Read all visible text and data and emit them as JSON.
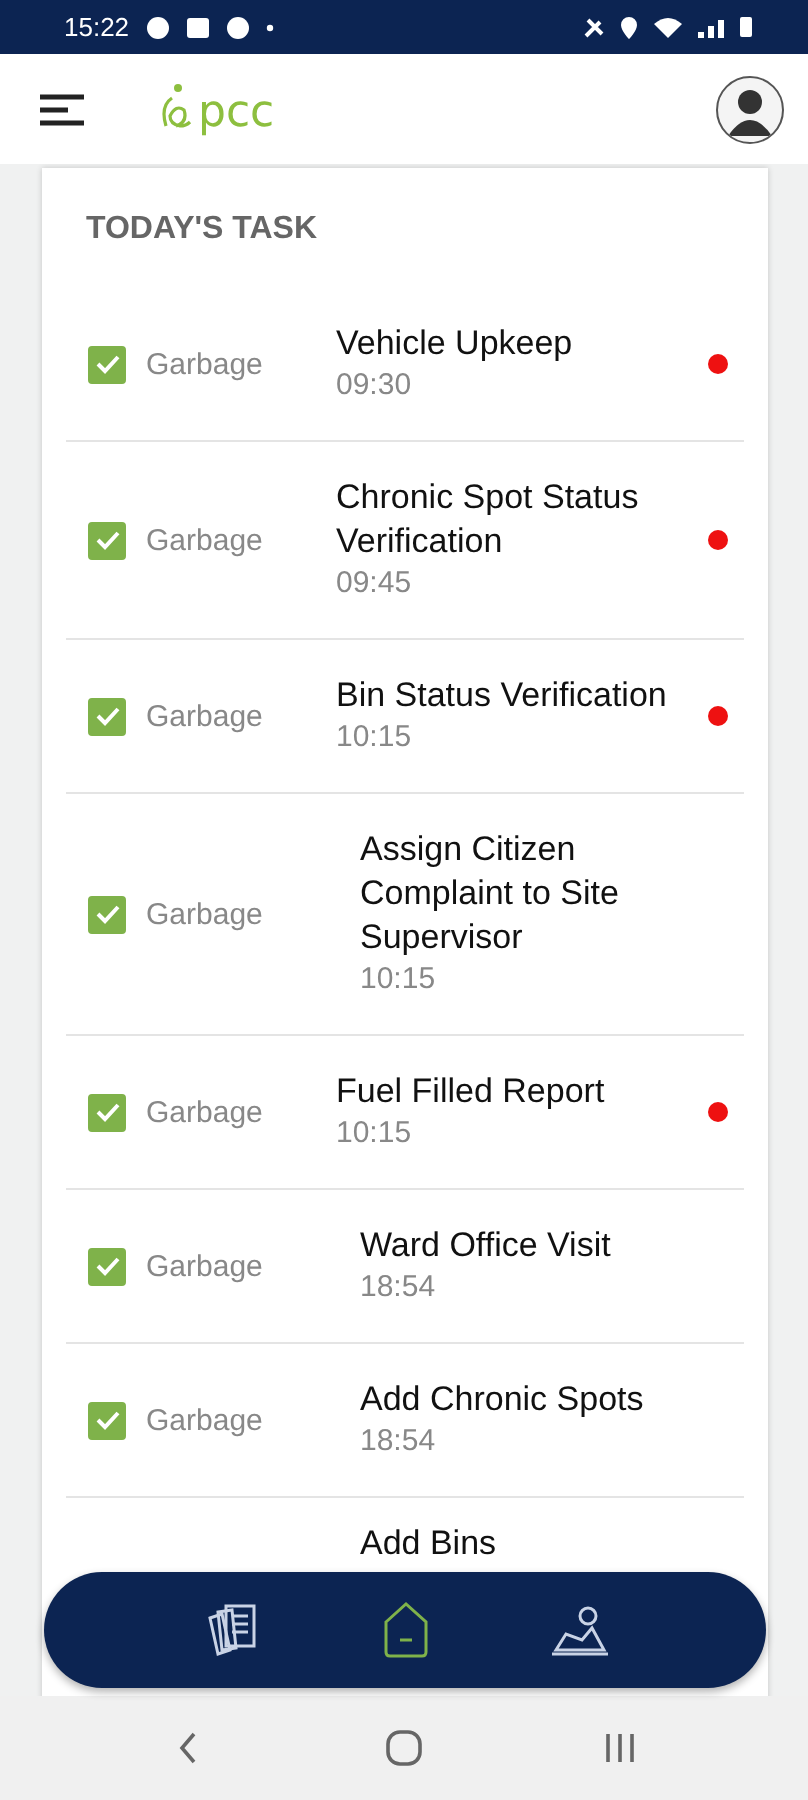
{
  "status_bar": {
    "time": "15:22"
  },
  "header": {
    "logo_text": "pcc"
  },
  "section_title": "TODAY'S TASK",
  "tasks": [
    {
      "checked": true,
      "category": "Garbage",
      "title": "Vehicle Upkeep",
      "time": "09:30",
      "alert": true
    },
    {
      "checked": true,
      "category": "Garbage",
      "title": "Chronic Spot Status Verification",
      "time": "09:45",
      "alert": true
    },
    {
      "checked": true,
      "category": "Garbage",
      "title": "Bin Status Verification",
      "time": "10:15",
      "alert": true
    },
    {
      "checked": true,
      "category": "Garbage",
      "title": "Assign Citizen Complaint to Site Supervisor",
      "time": "10:15",
      "alert": false
    },
    {
      "checked": true,
      "category": "Garbage",
      "title": "Fuel Filled Report",
      "time": "10:15",
      "alert": true
    },
    {
      "checked": true,
      "category": "Garbage",
      "title": "Ward Office Visit",
      "time": "18:54",
      "alert": false
    },
    {
      "checked": true,
      "category": "Garbage",
      "title": "Add Chronic Spots",
      "time": "18:54",
      "alert": false
    },
    {
      "kind": "partial",
      "title": "Add Bins"
    }
  ],
  "bottom_nav": [
    {
      "kind": "documents",
      "selected": false
    },
    {
      "kind": "home",
      "selected": true
    },
    {
      "kind": "profile",
      "selected": false
    }
  ]
}
